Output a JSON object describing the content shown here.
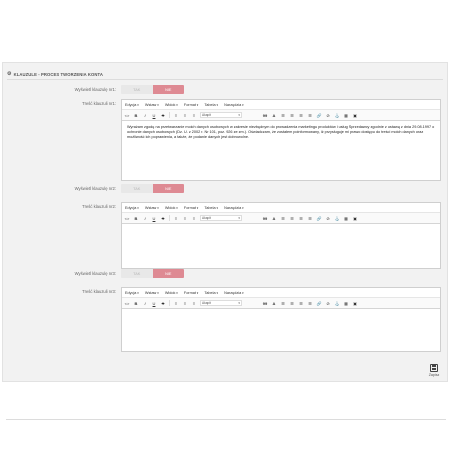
{
  "panel": {
    "title": "KLAUZULE - PROCES TWORZENIA KONTA",
    "icon": "gear-icon"
  },
  "toggle": {
    "off_label": "TAK",
    "on_label": "NIE",
    "active_color": "#de8a93"
  },
  "editor_menu": [
    "Edycja",
    "Wstaw",
    "Widok",
    "Format",
    "Tabela",
    "Narzędzia"
  ],
  "toolbar": {
    "source": "<>",
    "bold": "B",
    "italic": "I",
    "underline": "U",
    "strike": "S",
    "format_select": "Akapit",
    "quote": "99",
    "text_color": "A"
  },
  "clauses": [
    {
      "show_label": "Wyświetl klauzulę nr1:",
      "content_label": "Treść klauzuli nr1:",
      "content": "Wyrażam zgodę na przetwarzanie moich danych osobowych w zakresie niezbędnym do prowadzenia marketingu produktów i usług Sprzedawcy zgodnie z ustawą z dnia 29.08.1997 o ochronie danych osobowych (Dz. U. z 2002 r. Nr 101, poz. 926 ze zm.). Oświadczam, że zostałem poinformowany, iż przysługuje mi prawo dostępu do treści moich danych oraz możliwość ich poprawienia, a także, że podanie danych jest dobrowolne."
    },
    {
      "show_label": "Wyświetl klauzulę nr2:",
      "content_label": "Treść klauzuli nr2:",
      "content": ""
    },
    {
      "show_label": "Wyświetl klauzulę nr3:",
      "content_label": "Treść klauzuli nr3:",
      "content": ""
    }
  ],
  "save": {
    "label": "Zapisz",
    "icon": "floppy-disk-icon"
  }
}
